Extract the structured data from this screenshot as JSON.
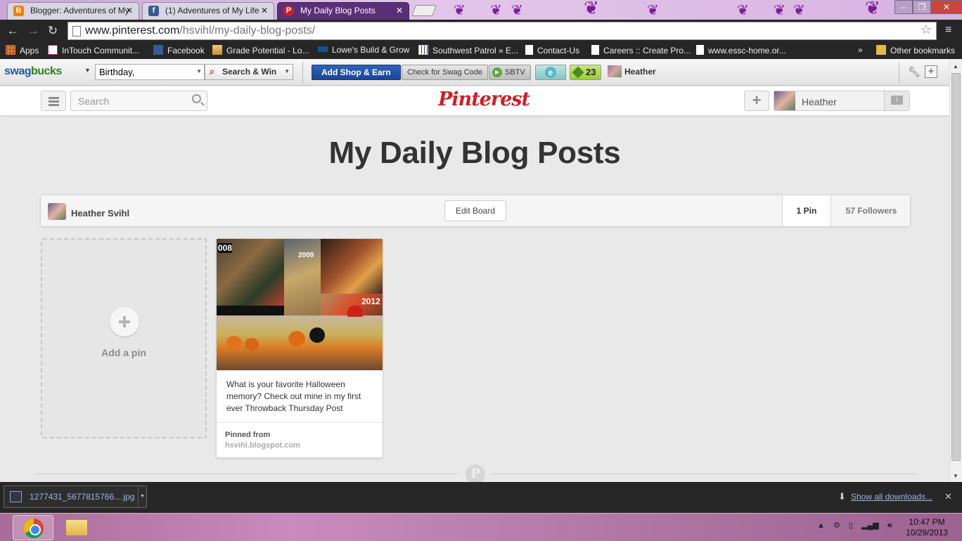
{
  "browser": {
    "tabs": [
      {
        "title": "Blogger: Adventures of My",
        "favicon": "blogger-icon",
        "favicon_color": "#f57d00",
        "active": false
      },
      {
        "title": "(1) Adventures of My Life",
        "favicon": "facebook-icon",
        "favicon_color": "#3b5998",
        "active": false
      },
      {
        "title": "My Daily Blog Posts",
        "favicon": "pinterest-icon",
        "favicon_color": "#cb2027",
        "active": true
      }
    ],
    "url_host": "www.pinterest.com",
    "url_path": "/hsvihl/my-daily-blog-posts/",
    "bookmarks": [
      {
        "label": "Apps",
        "icon": "apps-grid-icon"
      },
      {
        "label": "InTouch Communit...",
        "icon": "intouch-icon"
      },
      {
        "label": "Facebook",
        "icon": "facebook-icon"
      },
      {
        "label": "Grade Potential - Lo...",
        "icon": "grade-potential-icon"
      },
      {
        "label": "Lowe's Build & Grow",
        "icon": "lowes-icon"
      },
      {
        "label": "Southwest Patrol » E...",
        "icon": "grid-page-icon"
      },
      {
        "label": "Contact-Us",
        "icon": "page-icon"
      },
      {
        "label": "Careers :: Create Pro...",
        "icon": "page-icon"
      },
      {
        "label": "www.essc-home.or...",
        "icon": "page-icon"
      }
    ],
    "bookmarks_overflow": "»",
    "other_bookmarks": "Other bookmarks"
  },
  "swagbucks": {
    "logo_swag": "swag",
    "logo_bucks": "bucks",
    "search_value": "Birthday,",
    "search_button": "Search & Win",
    "add_shop": "Add Shop & Earn",
    "check_code": "Check for Swag Code",
    "sbtv": "SBTV",
    "e_label": "e",
    "count": "23",
    "user": "Heather"
  },
  "pinterest": {
    "logo": "Pinterest",
    "search_placeholder": "Search",
    "add_icon": "+",
    "user_name": "Heather",
    "board_title": "My Daily Blog Posts",
    "owner": "Heather Svihl",
    "edit_board": "Edit Board",
    "pin_count": "1 Pin",
    "followers": "57 Followers",
    "add_pin": "Add a pin",
    "pin": {
      "caption": "What is your favorite Halloween memory? Check out mine in my first ever Throwback Thursday Post",
      "pinned_from_label": "Pinned from",
      "source": "hsvihl.blogspot.com",
      "image_year_labels": [
        "008",
        "2009",
        "2012"
      ]
    },
    "footer_logo": "P"
  },
  "downloads": {
    "file": "1277431_5677815766....jpg",
    "show_all": "Show all downloads..."
  },
  "taskbar": {
    "time": "10:47 PM",
    "date": "10/29/2013"
  }
}
